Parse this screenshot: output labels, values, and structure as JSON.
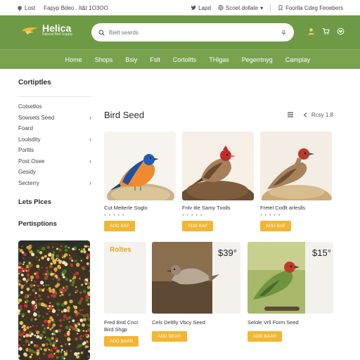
{
  "topbar": {
    "left_items": [
      "Lost",
      "Fapyp Bdeo . It&t 1O3OO"
    ],
    "right_items": [
      "Lapd",
      "Scoet dollate",
      "Foorlla Cdeg Feoebers"
    ]
  },
  "header": {
    "brand": "Helica",
    "tagline": "Natural Bird Supply",
    "search_placeholder": "Bielt seards"
  },
  "nav": {
    "items": [
      "Home",
      "Shops",
      "Bsiy",
      "Fslt",
      "Cortoltts",
      "THlgas",
      "Pegerrtnyg",
      "Camplay"
    ]
  },
  "sidebar": {
    "title": "Cortiptles",
    "items": [
      {
        "label": "Cotsetlos",
        "chevron": false
      },
      {
        "label": "Sowsets Seed",
        "chevron": true
      },
      {
        "label": "Foard",
        "chevron": false
      },
      {
        "label": "Loulsdity",
        "chevron": true
      },
      {
        "label": "Porltis",
        "chevron": false
      },
      {
        "label": "Post Osee",
        "chevron": true
      },
      {
        "label": "Gesidy",
        "chevron": false
      },
      {
        "label": "Secterry",
        "chevron": true
      }
    ],
    "heading_2": "Lets Plces",
    "heading_3": "Pertisptions"
  },
  "main": {
    "title": "Bird Seed",
    "sort_label": "Rcsy 1.8",
    "products": [
      {
        "title": "Cut Melterle Soglo",
        "button": "ADD BAF"
      },
      {
        "title": "Fnlv itle Samy Tvolls",
        "button": "ADD BAF"
      },
      {
        "title": "Fretel Codlt arleslls",
        "button": "ADD BAF"
      }
    ],
    "row2": [
      {
        "label": "Roltes",
        "title_line1": "Fred Bnd Cncr",
        "title_line2": "Bird Shgp",
        "button": "ADD BAAR"
      },
      {
        "price": "$39°",
        "title": "Cels Deltlly Vbcy Seed",
        "button": "ADD DEAR"
      },
      {
        "price": "$15°",
        "title": "Selole Vrll Form Seed",
        "button": "ADD BAAR"
      }
    ]
  },
  "colors": {
    "header_green": "#6f9a45",
    "nav_green": "#79a24e",
    "accent_yellow": "#f3b532"
  }
}
